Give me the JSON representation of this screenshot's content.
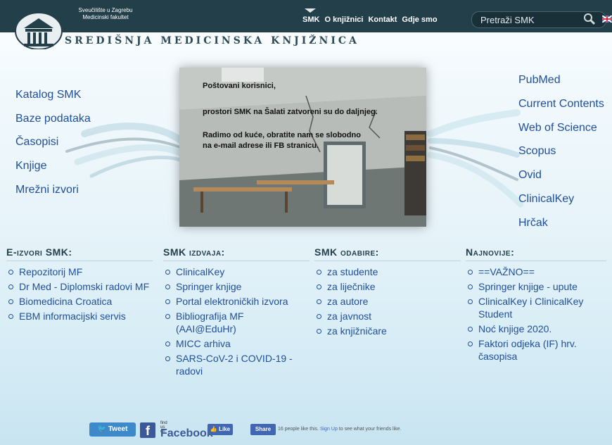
{
  "header": {
    "university_line1": "Sveučilište u Zagrebu",
    "university_line2": "Medicinski fakultet",
    "site_title": "Središnja medicinska knjižnica",
    "nav": [
      "SMK",
      "O knjižnici",
      "Kontakt",
      "Gdje smo"
    ],
    "search_placeholder": "Pretraži SMK",
    "search_icon": "magnifier-icon",
    "language_icon": "uk-flag-icon"
  },
  "left_links": [
    "Katalog SMK",
    "Baze podataka",
    "Časopisi",
    "Knjige",
    "Mrežni izvori"
  ],
  "right_links": [
    "PubMed",
    "Current Contents",
    "Web of Science",
    "Scopus",
    "Ovid",
    "ClinicalKey",
    "Hrčak"
  ],
  "banner": {
    "line1": "Poštovani korisnici,",
    "line2": "prostori SMK na Šalati zatvoreni su do daljnjeg.",
    "line3": "Radimo od kuće, obratite nam se slobodno",
    "line4": "na e-mail adrese ili FB stranicu."
  },
  "columns": [
    {
      "title": "E-izvori SMK:",
      "items": [
        "Repozitorij MF",
        "Dr Med - Diplomski radovi MF",
        "Biomedicina Croatica",
        "EBM informacijski servis"
      ]
    },
    {
      "title": "SMK izdvaja:",
      "items": [
        "ClinicalKey",
        "Springer knjige",
        "Portal elektroničkih izvora",
        "Bibliografija MF (AAI@EduHr)",
        "MICC arhiva",
        "SARS-CoV-2 i COVID-19 - radovi"
      ]
    },
    {
      "title": "SMK odabire:",
      "items": [
        "za studente",
        "za liječnike",
        "za autore",
        "za javnost",
        "za knjižničare"
      ]
    },
    {
      "title": "Najnovije:",
      "items": [
        "==VAŽNO==",
        "Springer knjige - upute",
        "ClinicalKey i ClinicalKey Student",
        "Noć knjige 2020.",
        "Faktori odjeka (IF) hrv. časopisa"
      ]
    }
  ],
  "social": {
    "tweet": "Tweet",
    "find_us": "find us on",
    "facebook": "Facebook",
    "like": "Like",
    "share": "Share",
    "likes_text": "16 people like this.",
    "signup": "Sign Up",
    "signup_suffix": "to see what your friends like."
  },
  "colors": {
    "header_bg": "#233f4a",
    "link": "#1f4f9a",
    "accent": "#3b5998"
  }
}
